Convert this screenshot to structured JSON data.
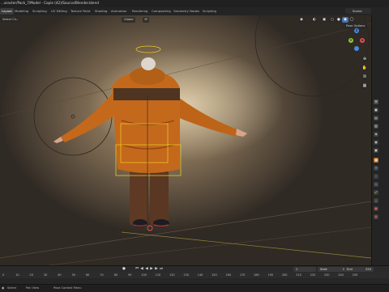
{
  "window": {
    "title": "...aracter/Pack_7/Model - Copie (42)/Source/Blender.blend"
  },
  "workspace_tabs": [
    "Layout",
    "Modeling",
    "Sculpting",
    "UV Editing",
    "Texture Paint",
    "Shading",
    "Animation",
    "Rendering",
    "Compositing",
    "Geometry Nodes",
    "Scripting"
  ],
  "active_tab": "Layout",
  "scene": {
    "label": "Scene"
  },
  "viewport": {
    "select_mode": "Select Cir...",
    "transform_orientation": "Global",
    "pose_options": "Pose Options",
    "gizmo_labels": {
      "x": "X",
      "y": "Y",
      "z": "Z"
    }
  },
  "timeline": {
    "current_frame": "1",
    "start_label": "Start",
    "start_value": "1",
    "end_label": "End",
    "end_value": "250",
    "ruler_ticks": [
      "0",
      "10",
      "20",
      "30",
      "40",
      "50",
      "60",
      "70",
      "80",
      "90",
      "100",
      "110",
      "120",
      "130",
      "140",
      "150",
      "160",
      "170",
      "180",
      "190",
      "200",
      "210",
      "220",
      "230",
      "240",
      "250"
    ]
  },
  "statusbar": {
    "select_label": "Select",
    "pan_label": "Pan View",
    "context_label": "Pose Context Menu"
  },
  "colors": {
    "jacket": "#c4681c",
    "jacket_dark": "#8a4510",
    "pants": "#5e3a24",
    "bone_outline": "#e8c820",
    "accent_blue": "#4772b3",
    "gizmo_x": "#e44d5a",
    "gizmo_y": "#8cc43c",
    "gizmo_z": "#4a8ae0"
  },
  "icons": [
    "blender-logo-icon",
    "scene-icon",
    "camera-icon",
    "hand-icon",
    "zoom-icon",
    "grid-icon",
    "play-icon",
    "jump-start-icon",
    "jump-end-icon",
    "keyframe-prev-icon",
    "keyframe-next-icon",
    "mouse-icon"
  ]
}
